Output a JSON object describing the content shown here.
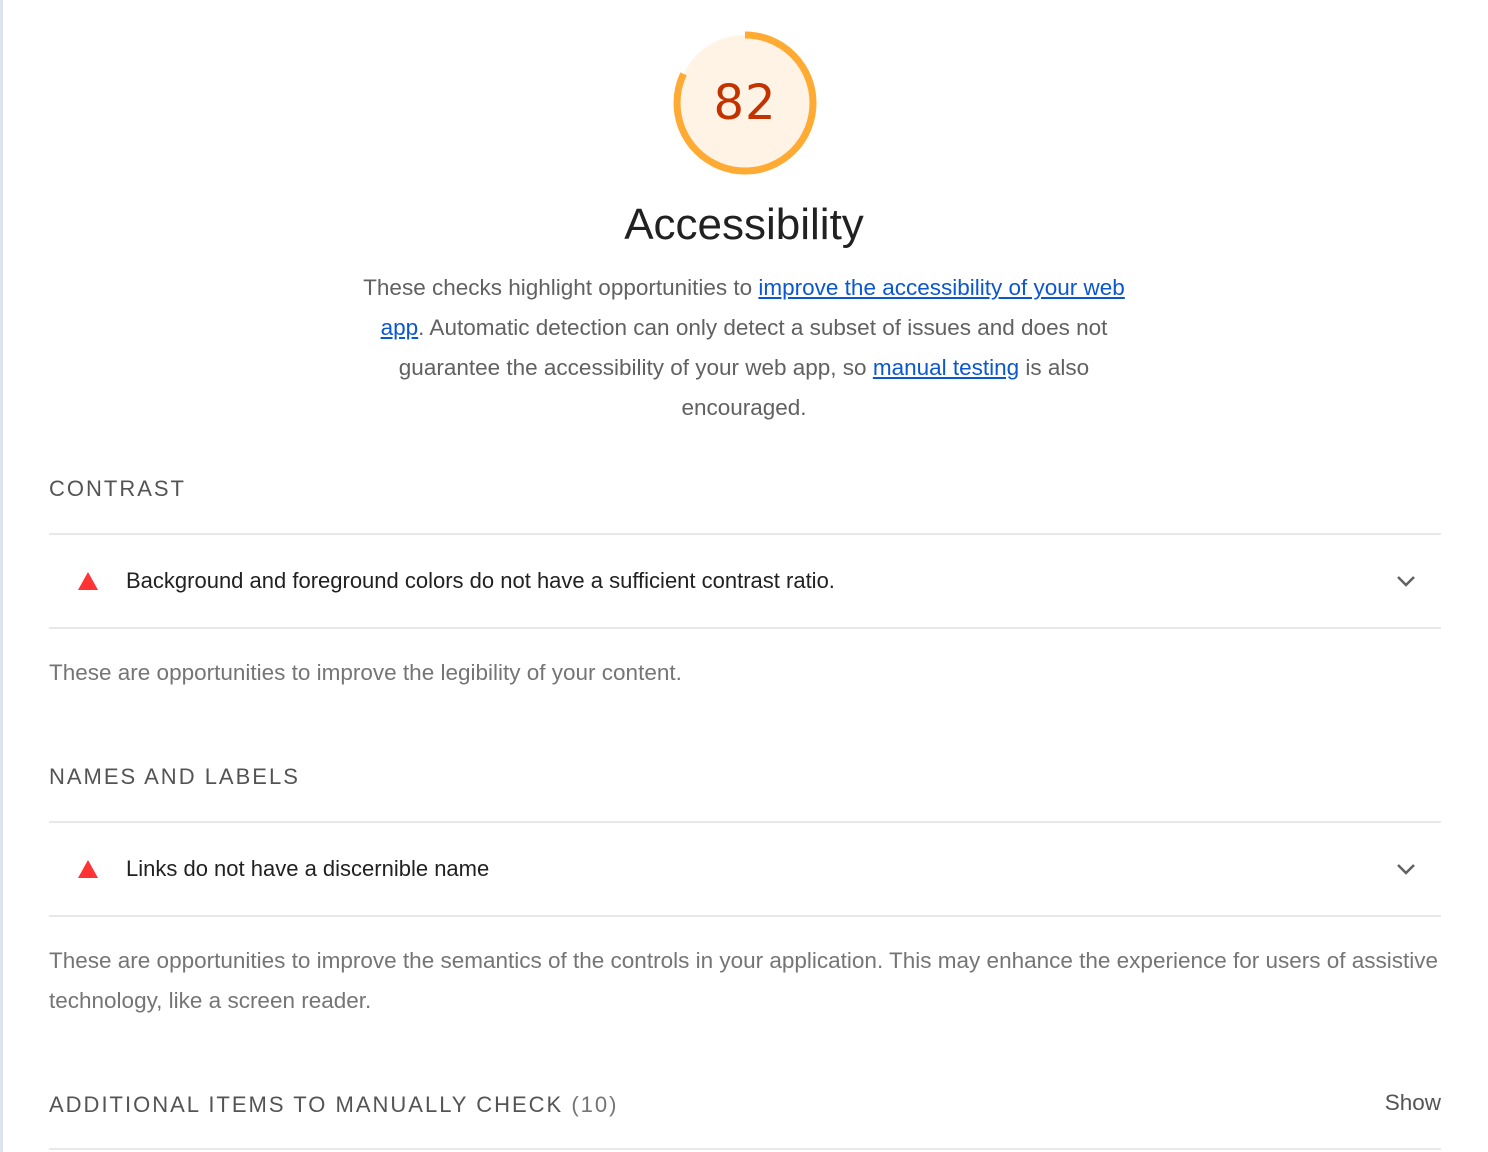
{
  "score": {
    "value": "82",
    "fraction": 0.82,
    "ring_color": "#ffaa33",
    "fill_color": "#fff3e6",
    "text_color": "#c33300"
  },
  "category": {
    "title": "Accessibility",
    "description": {
      "part1": "These checks highlight opportunities to ",
      "link1": "improve the accessibility of your web app",
      "part2": ". Automatic detection can only detect a subset of issues and does not guarantee the accessibility of your web app, so ",
      "link2": "manual testing",
      "part3": " is also encouraged."
    }
  },
  "groups": {
    "contrast": {
      "title": "CONTRAST",
      "audit": {
        "title": "Background and foreground colors do not have a sufficient contrast ratio.",
        "icon": "fail-triangle-icon"
      },
      "description": "These are opportunities to improve the legibility of your content."
    },
    "names": {
      "title": "NAMES AND LABELS",
      "audit": {
        "title": "Links do not have a discernible name",
        "icon": "fail-triangle-icon"
      },
      "description": "These are opportunities to improve the semantics of the controls in your application. This may enhance the experience for users of assistive technology, like a screen reader."
    },
    "manual": {
      "title": "ADDITIONAL ITEMS TO MANUALLY CHECK",
      "count": "(10)",
      "show_label": "Show"
    }
  },
  "colors": {
    "fail": "#ff3333",
    "link": "#0b57d0"
  }
}
